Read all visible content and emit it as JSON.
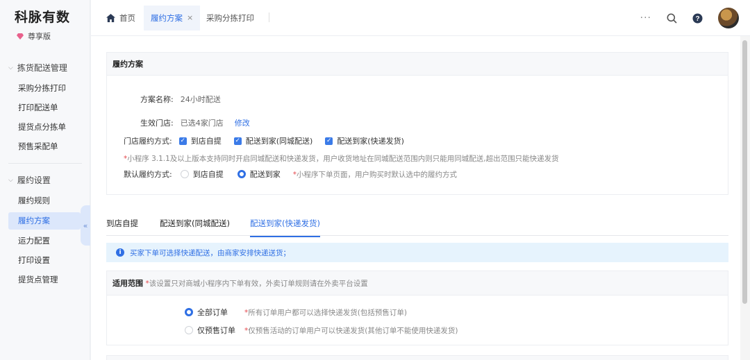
{
  "brand": {
    "name": "科脉有数",
    "edition": "尊享版"
  },
  "sidebar": {
    "groups": [
      {
        "title": "拣货配送管理",
        "items": [
          "采购分拣打印",
          "打印配送单",
          "提货点分拣单",
          "预售采配单"
        ]
      },
      {
        "title": "履约设置",
        "items": [
          "履约规则",
          "履约方案",
          "运力配置",
          "打印设置",
          "提货点管理"
        ]
      }
    ],
    "active_item": "履约方案",
    "collapse_glyph": "«"
  },
  "topbar": {
    "tabs": [
      {
        "label": "首页",
        "icon": "home-icon"
      },
      {
        "label": "履约方案",
        "close": "×"
      },
      {
        "label": "采购分拣打印"
      }
    ],
    "more": "···",
    "icons": [
      "search-icon",
      "help-icon",
      "avatar"
    ]
  },
  "plan_card": {
    "title": "履约方案",
    "name_label": "方案名称:",
    "name_value": "24小时配送",
    "stores_label": "生效门店:",
    "stores_value": "已选4家门店",
    "stores_link": "修改",
    "methods_label": "门店履约方式:",
    "methods": [
      "到店自提",
      "配送到家(同城配送)",
      "配送到家(快递发货)"
    ],
    "methods_note": "*小程序 3.1.1及以上版本支持同时开启同城配送和快递发货，用户收货地址在同城配送范围内则只能用同城配送,超出范围只能快递发货",
    "default_label": "默认履约方式:",
    "default_options": [
      "到店自提",
      "配送到家"
    ],
    "default_selected": "配送到家",
    "default_note": "*小程序下单页面，用户购买时默认选中的履约方式"
  },
  "subtabs": {
    "items": [
      "到店自提",
      "配送到家(同城配送)",
      "配送到家(快递发货)"
    ],
    "active": "配送到家(快递发货)"
  },
  "info_bar": {
    "text": "买家下单可选择快递配送，由商家安排快递送货；"
  },
  "scope_card": {
    "title": "适用范围",
    "title_note": "*该设置只对商城小程序内下单有效，外卖订单规则请在外卖平台设置",
    "options": [
      {
        "label": "全部订单",
        "note": "*所有订单用户都可以选择快递发货(包括预售订单)",
        "selected": true
      },
      {
        "label": "仅预售订单",
        "note": "*仅预售活动的订单用户可以快递发货(其他订单不能使用快递发货)",
        "selected": false
      }
    ]
  },
  "colors": {
    "accent": "#2f6fe4",
    "required": "#e5484d",
    "info_bg": "#e6f3fd"
  }
}
